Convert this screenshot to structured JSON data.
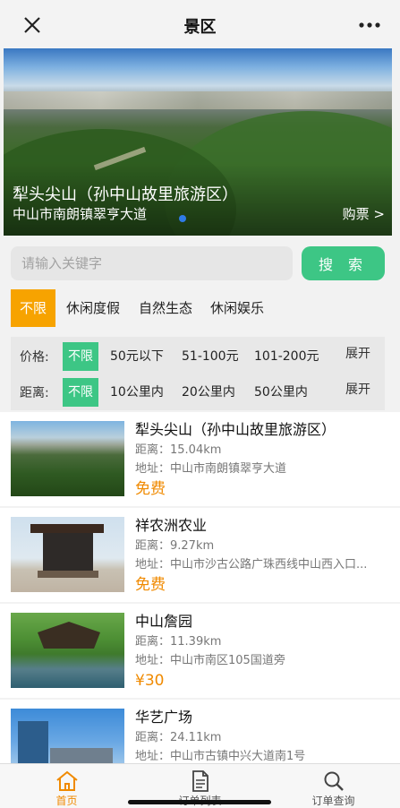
{
  "header": {
    "title": "景区"
  },
  "banner": {
    "name": "犁头尖山（孙中山故里旅游区）",
    "address": "中山市南朗镇翠亨大道",
    "buy_label": "购票 >"
  },
  "search": {
    "placeholder": "请输入关键字",
    "button_label": "搜 索"
  },
  "categories": [
    "不限",
    "休闲度假",
    "自然生态",
    "休闲娱乐"
  ],
  "filters": {
    "price": {
      "label": "价格:",
      "options": [
        "不限",
        "50元以下",
        "51-100元",
        "101-200元"
      ],
      "expand": "展开"
    },
    "distance": {
      "label": "距离:",
      "options": [
        "不限",
        "10公里内",
        "20公里内",
        "50公里内"
      ],
      "expand": "展开"
    }
  },
  "spots": [
    {
      "name": "犁头尖山（孙中山故里旅游区）",
      "distance": "距离：15.04km",
      "address": "地址：中山市南朗镇翠亨大道",
      "price": "免费"
    },
    {
      "name": "祥农洲农业",
      "distance": "距离：9.27km",
      "address": "地址：中山市沙古公路广珠西线中山西入口...",
      "price": "免费"
    },
    {
      "name": "中山詹园",
      "distance": "距离：11.39km",
      "address": "地址：中山市南区105国道旁",
      "price": "¥30"
    },
    {
      "name": "华艺广场",
      "distance": "距离：24.11km",
      "address": "地址：中山市古镇中兴大道南1号",
      "price": ""
    }
  ],
  "tabs": [
    {
      "label": "首页",
      "icon": "home-icon"
    },
    {
      "label": "订单列表",
      "icon": "document-icon"
    },
    {
      "label": "订单查询",
      "icon": "search-icon"
    }
  ],
  "colors": {
    "accent_orange": "#f7a300",
    "accent_green": "#3dc685",
    "price_orange": "#f08a00"
  }
}
